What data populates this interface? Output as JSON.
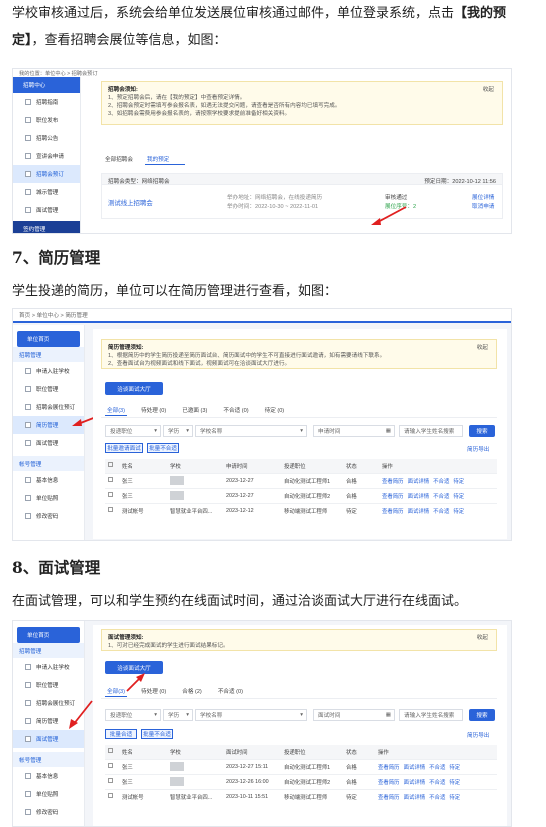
{
  "intro": {
    "text_a": "学校审核通过后，系统会给单位发送展位审核通过邮件，单位登录系统，点击",
    "bracket_open": "【",
    "bold_a": "我的预定",
    "bracket_close": "】",
    "text_b": "，查看招聘会展位等信息，如图："
  },
  "shot1": {
    "breadcrumb": "我的位置：单位中心 > 招聘会预订",
    "sidebar": {
      "header": "招聘中心",
      "items": [
        "招聘指南",
        "职位发布",
        "招聘公告",
        "宣讲会申请",
        "招聘会预订",
        "城示管理",
        "面试管理"
      ],
      "footer": "签约管理"
    },
    "notice": {
      "title": "招聘会须知:",
      "collapse": "收起",
      "lines": [
        "1、预定招聘会后，请在【我的预定】中查看预定详情。",
        "2、招聘会预定时需填写参会报名表，如遇无法提交问题，请查看是否所有内容均已填写完成。",
        "3、如招聘会需费用参会报名表的，请按照学校要求提前准备好相关资料。"
      ]
    },
    "tabs": [
      "全部招聘会",
      "我的预定"
    ],
    "type_label": "招聘会类型：网络招聘会",
    "reserve_time": "预定日期：2022-10-12 11:56",
    "fair_name": "测试线上招聘会",
    "address": "举办地址：网络招聘会，在线投递简历",
    "hold_time": "举办时间：2022-10-30 ~ 2022-11-01",
    "status": "审核通过",
    "booth": "展位序号：2",
    "ops": [
      "展位详情",
      "取消申请"
    ]
  },
  "sec7": {
    "heading": "7、简历管理",
    "para": "学生投递的简历，单位可以在简历管理进行查看，如图："
  },
  "shot2": {
    "breadcrumb": "首页 > 单位中心 > 简历管理",
    "sidebar": {
      "header": "单位首页",
      "cat1": "招聘管理",
      "items1": [
        "申请入驻学校",
        "职位管理",
        "招聘会展位预订",
        "简历管理",
        "面试管理"
      ],
      "cat2": "帐号管理",
      "items2": [
        "基本信息",
        "单位贴照",
        "修改密码"
      ]
    },
    "notice": {
      "title": "简历管理须知:",
      "collapse": "收起",
      "lines": [
        "1、根据简历中的学生简历投递至简历面试台、简历面试中的学生不可直接进行面试邀请，如有需要请线下联系。",
        "2、查看面试台为视频面试和线下面试，视频面试可在洽谈面试大厅进行。"
      ]
    },
    "hall_button": "洽谈面试大厅",
    "tabs": [
      "全部(3)",
      "待处理 (0)",
      "已邀面 (3)",
      "不合适 (0)",
      "待定 (0)"
    ],
    "filters": [
      "投递职位",
      "学历",
      "学校名称",
      "申请时间",
      "请输入学生姓名搜索"
    ],
    "search": "搜索",
    "bulk": [
      "批量邀请面试",
      "批量不合适"
    ],
    "export": "简历导出",
    "columns": [
      "姓名",
      "学校",
      "申请时间",
      "投递职位",
      "状态",
      "操作"
    ],
    "rows": [
      {
        "name": "张三",
        "school": "",
        "time": "2023-12-27",
        "job": "自动化测试工程师1",
        "status": "合格",
        "ops": [
          "查看简历",
          "面试详情",
          "不合适",
          "待定"
        ]
      },
      {
        "name": "张三",
        "school": "",
        "time": "2023-12-27",
        "job": "自动化测试工程师2",
        "status": "合格",
        "ops": [
          "查看简历",
          "面试详情",
          "不合适",
          "待定"
        ]
      },
      {
        "name": "测试帐号",
        "school": "智慧就业平台四...",
        "time": "2023-12-12",
        "job": "移动端测试工程师",
        "status": "待定",
        "ops": [
          "查看简历",
          "面试详情",
          "不合适",
          "待定"
        ]
      }
    ]
  },
  "sec8": {
    "heading": "8、面试管理",
    "para": "在面试管理，可以和学生预约在线面试时间，通过洽谈面试大厅进行在线面试。"
  },
  "shot3": {
    "sidebar": {
      "header": "单位首页",
      "cat1": "招聘管理",
      "items1": [
        "申请入驻学校",
        "职位管理",
        "招聘会展位预订",
        "简历管理",
        "面试管理"
      ],
      "cat2": "帐号管理",
      "items2": [
        "基本信息",
        "单位贴照",
        "修改密码"
      ]
    },
    "notice": {
      "title": "面试管理须知:",
      "collapse": "收起",
      "lines": [
        "1、可对已经完成面试的学生进行面试结果标记。"
      ]
    },
    "hall_button": "洽谈面试大厅",
    "tabs": [
      "全部(3)",
      "待处理 (0)",
      "合格 (2)",
      "不合适 (0)"
    ],
    "filters": [
      "投递职位",
      "学历",
      "学校名称",
      "面试时间",
      "请输入学生姓名搜索"
    ],
    "search": "搜索",
    "bulk": [
      "批量合适",
      "批量不合适"
    ],
    "export": "简历导出",
    "columns": [
      "姓名",
      "学校",
      "面试时间",
      "投递职位",
      "状态",
      "操作"
    ],
    "rows": [
      {
        "name": "张三",
        "school": "",
        "time": "2023-12-27 15:11",
        "job": "自动化测试工程师1",
        "status": "合格",
        "ops": [
          "查看简历",
          "面试详情",
          "不合适",
          "待定"
        ]
      },
      {
        "name": "张三",
        "school": "",
        "time": "2023-12-26 16:00",
        "job": "自动化测试工程师2",
        "status": "合格",
        "ops": [
          "查看简历",
          "面试详情",
          "不合适",
          "待定"
        ]
      },
      {
        "name": "测试帐号",
        "school": "智慧就业平台四...",
        "time": "2023-10-11 15:51",
        "job": "移动端测试工程师",
        "status": "待定",
        "ops": [
          "查看简历",
          "面试详情",
          "不合适",
          "待定"
        ]
      }
    ]
  },
  "colors": {
    "primary": "#2a63d9",
    "notice_bg": "#fffbea",
    "arrow": "#e02020"
  },
  "icons": [
    "checkbox-icon",
    "calendar-icon",
    "chevron-down-icon",
    "red-arrow-icon",
    "menu-item-icon"
  ]
}
